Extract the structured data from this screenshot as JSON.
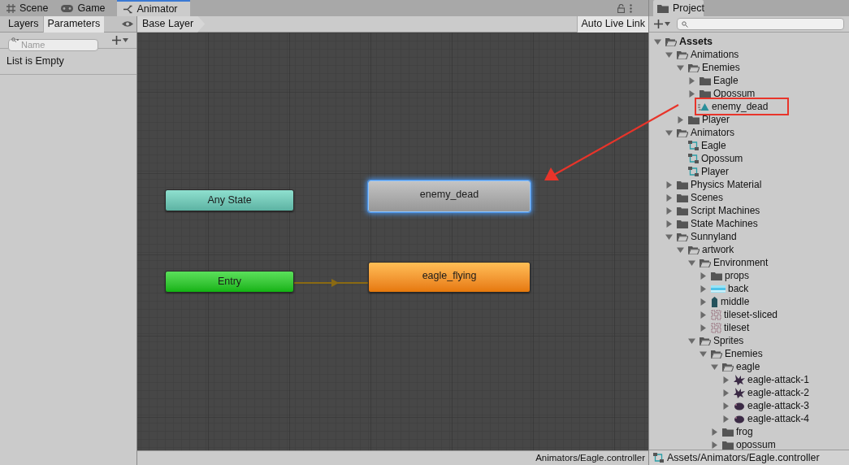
{
  "window_tabs": [
    {
      "label": "Scene",
      "kind": "scene",
      "selected": false
    },
    {
      "label": "Game",
      "kind": "game",
      "selected": false
    },
    {
      "label": "Animator",
      "kind": "animator",
      "selected": true
    }
  ],
  "animator": {
    "panel_tabs": [
      {
        "label": "Layers",
        "selected": false
      },
      {
        "label": "Parameters",
        "selected": true
      }
    ],
    "search": {
      "placeholder": "Name"
    },
    "empty_message": "List is Empty",
    "breadcrumb": "Base Layer",
    "live_link_button": "Auto Live Link",
    "nodes": [
      {
        "label": "Any State",
        "kind": "any",
        "selected": false
      },
      {
        "label": "enemy_dead",
        "kind": "state",
        "selected": true
      },
      {
        "label": "Entry",
        "kind": "entry",
        "selected": false
      },
      {
        "label": "eagle_flying",
        "kind": "default",
        "selected": false
      }
    ],
    "status": "Animators/Eagle.controller"
  },
  "project": {
    "tab": "Project",
    "tree": [
      {
        "label": "Assets",
        "kind": "folder",
        "expanded": true,
        "children": [
          {
            "label": "Animations",
            "kind": "folder",
            "expanded": true,
            "children": [
              {
                "label": "Enemies",
                "kind": "folder",
                "expanded": true,
                "children": [
                  {
                    "label": "Eagle",
                    "kind": "folder",
                    "expanded": false
                  },
                  {
                    "label": "Opossum",
                    "kind": "folder",
                    "expanded": false
                  },
                  {
                    "label": "enemy_dead",
                    "kind": "clip",
                    "annotated": true
                  }
                ]
              },
              {
                "label": "Player",
                "kind": "folder",
                "expanded": false
              }
            ]
          },
          {
            "label": "Animators",
            "kind": "folder",
            "expanded": true,
            "children": [
              {
                "label": "Eagle",
                "kind": "controller"
              },
              {
                "label": "Opossum",
                "kind": "controller"
              },
              {
                "label": "Player",
                "kind": "controller"
              }
            ]
          },
          {
            "label": "Physics Material",
            "kind": "folder",
            "expanded": false
          },
          {
            "label": "Scenes",
            "kind": "folder",
            "expanded": false
          },
          {
            "label": "Script Machines",
            "kind": "folder",
            "expanded": false
          },
          {
            "label": "State Machines",
            "kind": "folder",
            "expanded": false
          },
          {
            "label": "Sunnyland",
            "kind": "folder",
            "expanded": true,
            "children": [
              {
                "label": "artwork",
                "kind": "folder",
                "expanded": true,
                "children": [
                  {
                    "label": "Environment",
                    "kind": "folder",
                    "expanded": true,
                    "children": [
                      {
                        "label": "props",
                        "kind": "folder",
                        "expanded": false
                      },
                      {
                        "label": "back",
                        "kind": "image-sky",
                        "expanded": false
                      },
                      {
                        "label": "middle",
                        "kind": "image-pillar",
                        "expanded": false
                      },
                      {
                        "label": "tileset-sliced",
                        "kind": "image-tiles",
                        "expanded": false
                      },
                      {
                        "label": "tileset",
                        "kind": "image-tiles",
                        "expanded": false
                      }
                    ]
                  },
                  {
                    "label": "Sprites",
                    "kind": "folder",
                    "expanded": true,
                    "children": [
                      {
                        "label": "Enemies",
                        "kind": "folder",
                        "expanded": true,
                        "children": [
                          {
                            "label": "eagle",
                            "kind": "folder",
                            "expanded": true,
                            "children": [
                              {
                                "label": "eagle-attack-1",
                                "kind": "image-bird",
                                "expanded": false
                              },
                              {
                                "label": "eagle-attack-2",
                                "kind": "image-bird",
                                "expanded": false
                              },
                              {
                                "label": "eagle-attack-3",
                                "kind": "image-ball",
                                "expanded": false
                              },
                              {
                                "label": "eagle-attack-4",
                                "kind": "image-ball",
                                "expanded": false
                              }
                            ]
                          },
                          {
                            "label": "frog",
                            "kind": "folder",
                            "expanded": false
                          },
                          {
                            "label": "opossum",
                            "kind": "folder",
                            "expanded": false
                          }
                        ]
                      }
                    ]
                  }
                ]
              }
            ]
          }
        ]
      }
    ],
    "status": "Assets/Animators/Eagle.controller"
  }
}
